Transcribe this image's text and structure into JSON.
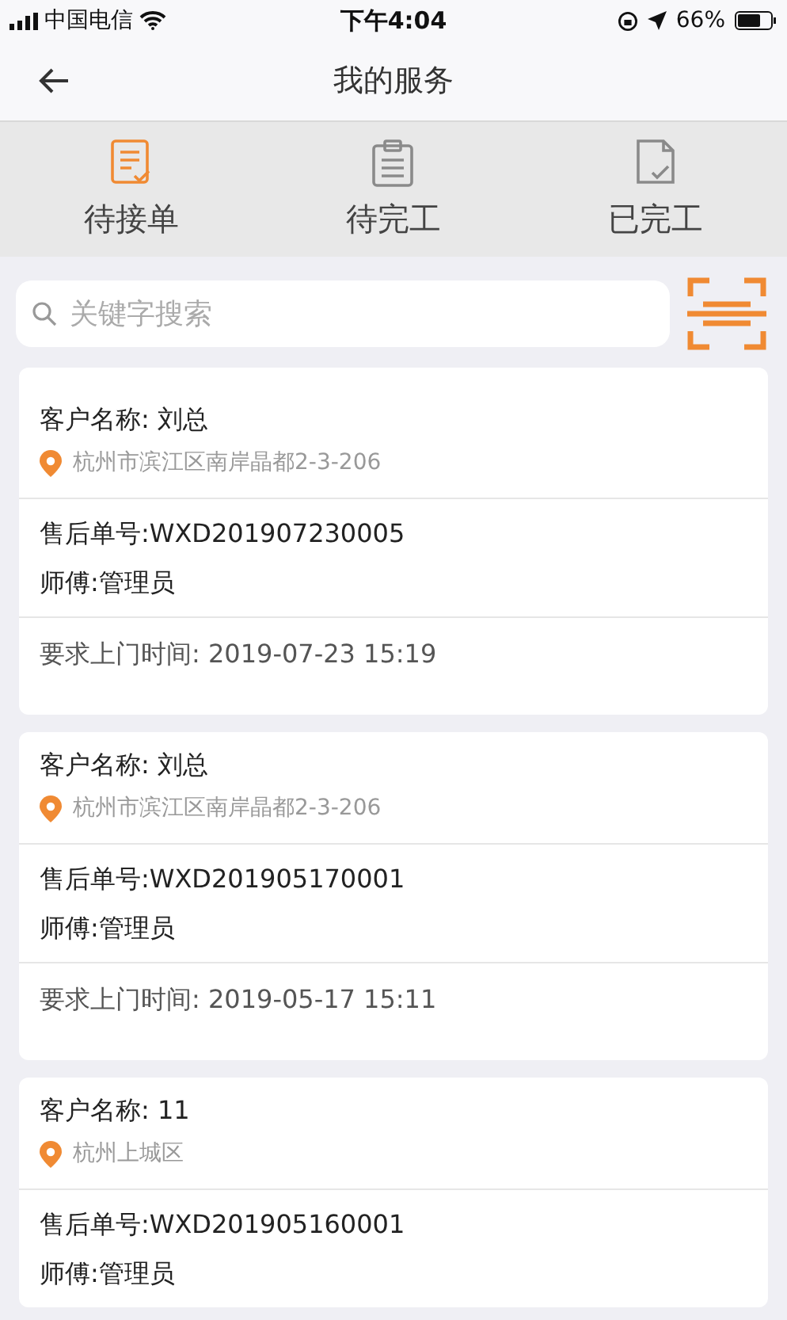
{
  "status_bar": {
    "carrier": "中国电信",
    "time": "下午4:04",
    "battery": "66%"
  },
  "nav": {
    "title": "我的服务"
  },
  "tabs": [
    {
      "label": "待接单",
      "selected": true
    },
    {
      "label": "待完工",
      "selected": false
    },
    {
      "label": "已完工",
      "selected": false
    }
  ],
  "search": {
    "placeholder": "关键字搜索"
  },
  "orders": [
    {
      "customer": "客户名称: 刘总",
      "address": "杭州市滨江区南岸晶都2-3-206",
      "order_no": "售后单号:WXD201907230005",
      "master": "师傅:管理员",
      "visit_time": "要求上门时间: 2019-07-23 15:19"
    },
    {
      "customer": "客户名称: 刘总",
      "address": "杭州市滨江区南岸晶都2-3-206",
      "order_no": "售后单号:WXD201905170001",
      "master": "师傅:管理员",
      "visit_time": "要求上门时间: 2019-05-17 15:11"
    },
    {
      "customer": "客户名称: 11",
      "address": "杭州上城区",
      "order_no": "售后单号:WXD201905160001",
      "master": "师傅:管理员"
    }
  ]
}
